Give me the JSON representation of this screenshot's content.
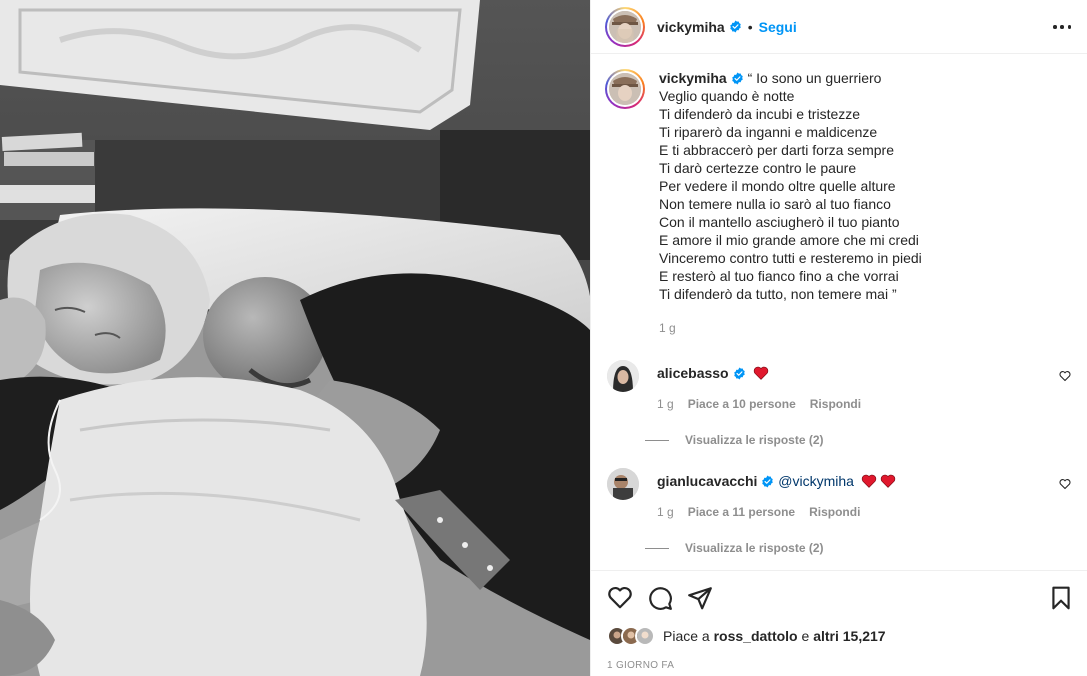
{
  "header": {
    "username": "vickymiha",
    "separator": "•",
    "follow_label": "Segui"
  },
  "caption": {
    "username": "vickymiha",
    "lines": [
      "“ Io sono un guerriero",
      "Veglio quando è notte",
      "Ti difenderò da incubi e tristezze",
      "Ti riparerò da inganni e maldicenze",
      "E ti abbraccerò per darti forza sempre",
      "Ti darò certezze contro le paure",
      "Per vedere il mondo oltre quelle alture",
      "Non temere nulla io sarò al tuo fianco",
      "Con il mantello asciugherò il tuo pianto",
      "E amore il mio grande amore che mi credi",
      "Vinceremo contro tutti e resteremo in piedi",
      "E resterò al tuo fianco fino a che vorrai",
      "Ti difenderò da tutto, non temere mai ”"
    ],
    "time": "1 g"
  },
  "comments": [
    {
      "username": "alicebasso",
      "text": "",
      "hearts": 1,
      "time": "1 g",
      "likes": "Piace a 10 persone",
      "reply_label": "Rispondi",
      "view_replies": "Visualizza le risposte (2)"
    },
    {
      "username": "gianlucavacchi",
      "mention": "@vickymiha",
      "hearts": 2,
      "time": "1 g",
      "likes": "Piace a 11 persone",
      "reply_label": "Rispondi",
      "view_replies": "Visualizza le risposte (2)"
    }
  ],
  "footer": {
    "likes_prefix": "Piace a ",
    "likes_user": "ross_dattolo",
    "likes_middle": " e ",
    "likes_others": "altri 15,217",
    "date": "1 giorno fa"
  },
  "icons": {
    "verified": "verified-badge-icon",
    "heart": "heart-emoji-icon",
    "like": "heart-outline-icon",
    "comment": "comment-bubble-icon",
    "share": "paper-plane-icon",
    "save": "bookmark-icon",
    "more": "more-options-icon"
  },
  "colors": {
    "accent": "#0095f6",
    "text": "#262626",
    "muted": "#8e8e8e",
    "verified": "#0095f6",
    "heart_emoji": "#e0182d"
  }
}
